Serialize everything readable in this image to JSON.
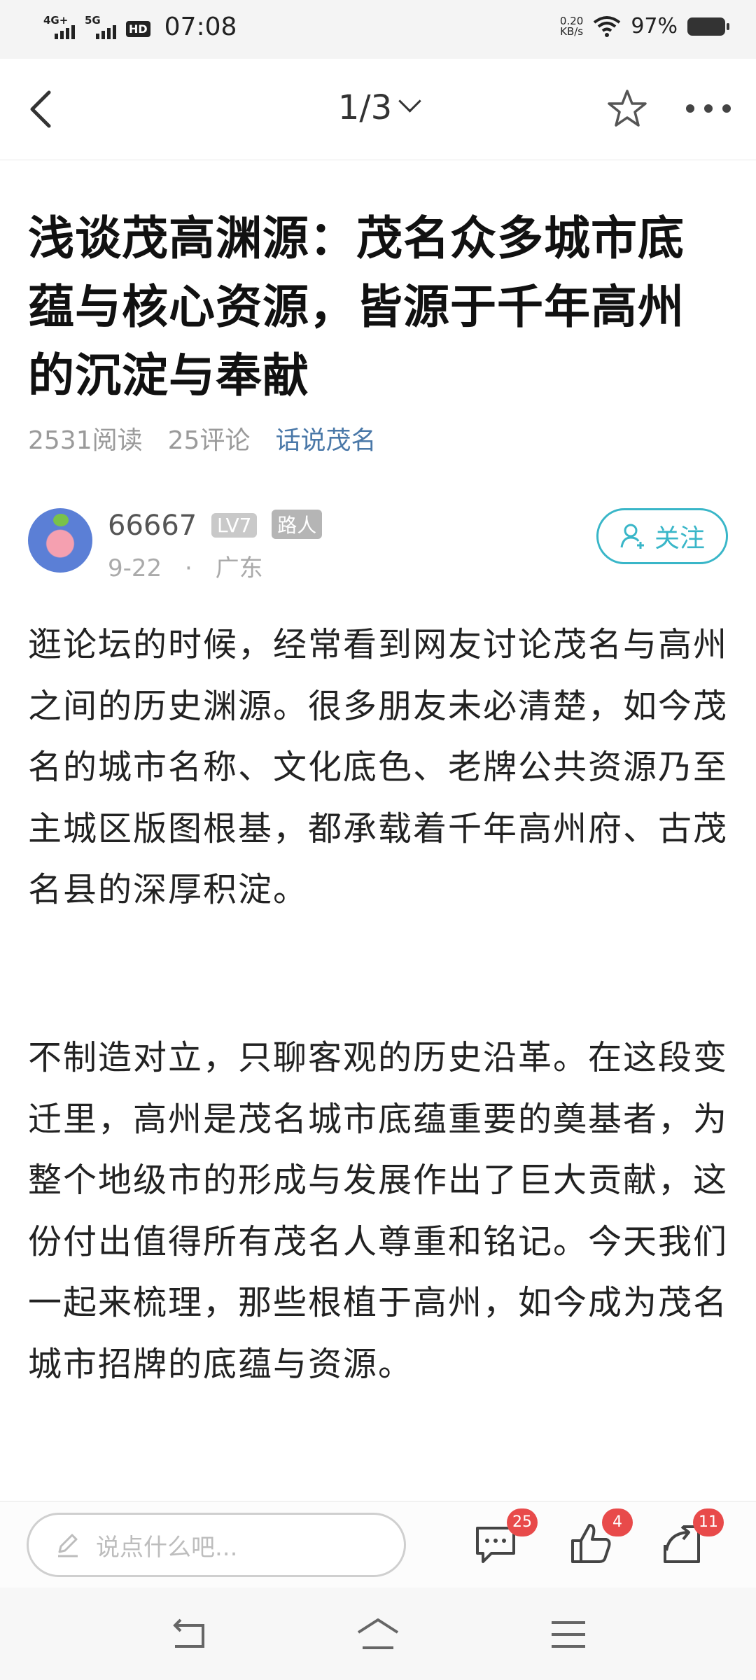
{
  "status_bar": {
    "sim1": "4G+",
    "sim2": "5G",
    "hd": "HD",
    "time": "07:08",
    "net_speed_value": "0.20",
    "net_speed_unit": "KB/s",
    "battery": "97%"
  },
  "nav": {
    "page_indicator": "1/3"
  },
  "article": {
    "title": "浅谈茂高渊源：茂名众多城市底蕴与核心资源，皆源于千年高州的沉淀与奉献",
    "reads": "2531阅读",
    "comments": "25评论",
    "forum": "话说茂名",
    "paragraphs": [
      "逛论坛的时候，经常看到网友讨论茂名与高州之间的历史渊源。很多朋友未必清楚，如今茂名的城市名称、文化底色、老牌公共资源乃至主城区版图根基，都承载着千年高州府、古茂名县的深厚积淀。",
      "不制造对立，只聊客观的历史沿革。在这段变迁里，高州是茂名城市底蕴重要的奠基者，为整个地级市的形成与发展作出了巨大贡献，这份付出值得所有茂名人尊重和铭记。今天我们一起来梳理，那些根植于高州，如今成为茂名城市招牌的底蕴与资源。"
    ]
  },
  "author": {
    "name": "66667",
    "level": "LV7",
    "role": "路人",
    "date": "9-22",
    "separator": "·",
    "location": "广东",
    "follow_label": "关注"
  },
  "comment_bar": {
    "placeholder": "说点什么吧...",
    "comment_count": "25",
    "like_count": "4",
    "share_count": "11"
  },
  "colors": {
    "accent": "#39b6c8",
    "forum_link": "#4a78a8",
    "badge_red": "#e84a4a"
  }
}
